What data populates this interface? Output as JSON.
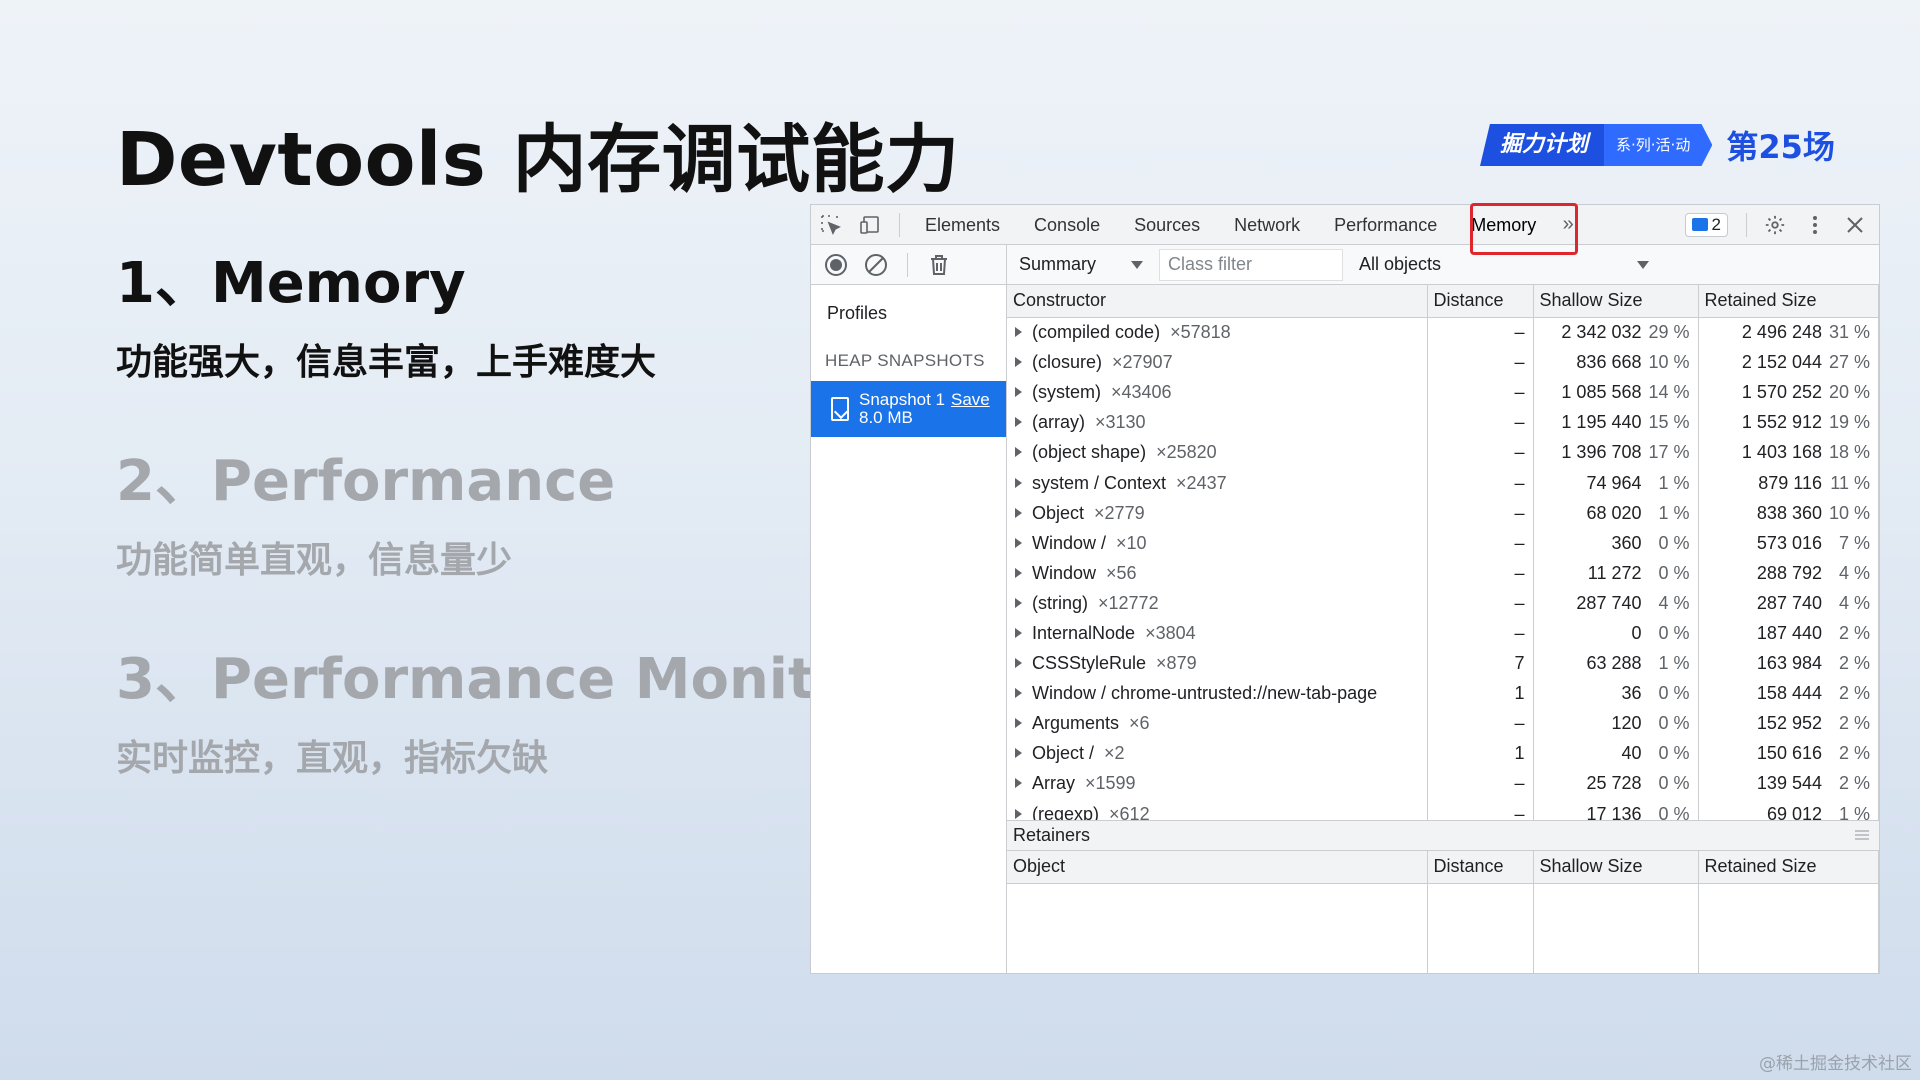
{
  "slide": {
    "title": "Devtools 内存调试能力",
    "items": [
      {
        "head": "1、Memory",
        "sub": "功能强大，信息丰富，上手难度大"
      },
      {
        "head": "2、Performance",
        "sub": "功能简单直观，信息量少"
      },
      {
        "head": "3、Performance Monitor",
        "sub": "实时监控，直观，指标欠缺"
      }
    ],
    "badge": {
      "main": "掘力计划",
      "series": "系·列·活·动",
      "episode": "第25场"
    },
    "watermark": "@稀土掘金技术社区"
  },
  "devtools": {
    "tabs": [
      "Elements",
      "Console",
      "Sources",
      "Network",
      "Performance",
      "Memory"
    ],
    "selected_tab": "Memory",
    "more_tabs": "»",
    "issues_count": "2",
    "toolbar": {
      "view": "Summary",
      "class_filter_placeholder": "Class filter",
      "objects": "All objects"
    },
    "sidebar": {
      "title": "Profiles",
      "section": "HEAP SNAPSHOTS",
      "snapshot_name": "Snapshot 1",
      "snapshot_save": "Save",
      "snapshot_size": "8.0 MB"
    },
    "columns": [
      "Constructor",
      "Distance",
      "Shallow Size",
      "Retained Size"
    ],
    "rows": [
      {
        "name": "(compiled code)",
        "count": "×57818",
        "distance": "–",
        "shallow": "2 342 032",
        "shallow_pct": "29 %",
        "retained": "2 496 248",
        "retained_pct": "31 %"
      },
      {
        "name": "(closure)",
        "count": "×27907",
        "distance": "–",
        "shallow": "836 668",
        "shallow_pct": "10 %",
        "retained": "2 152 044",
        "retained_pct": "27 %"
      },
      {
        "name": "(system)",
        "count": "×43406",
        "distance": "–",
        "shallow": "1 085 568",
        "shallow_pct": "14 %",
        "retained": "1 570 252",
        "retained_pct": "20 %"
      },
      {
        "name": "(array)",
        "count": "×3130",
        "distance": "–",
        "shallow": "1 195 440",
        "shallow_pct": "15 %",
        "retained": "1 552 912",
        "retained_pct": "19 %"
      },
      {
        "name": "(object shape)",
        "count": "×25820",
        "distance": "–",
        "shallow": "1 396 708",
        "shallow_pct": "17 %",
        "retained": "1 403 168",
        "retained_pct": "18 %"
      },
      {
        "name": "system / Context",
        "count": "×2437",
        "distance": "–",
        "shallow": "74 964",
        "shallow_pct": "1 %",
        "retained": "879 116",
        "retained_pct": "11 %"
      },
      {
        "name": "Object",
        "count": "×2779",
        "distance": "–",
        "shallow": "68 020",
        "shallow_pct": "1 %",
        "retained": "838 360",
        "retained_pct": "10 %"
      },
      {
        "name": "Window /",
        "count": "×10",
        "distance": "–",
        "shallow": "360",
        "shallow_pct": "0 %",
        "retained": "573 016",
        "retained_pct": "7 %"
      },
      {
        "name": "Window",
        "count": "×56",
        "distance": "–",
        "shallow": "11 272",
        "shallow_pct": "0 %",
        "retained": "288 792",
        "retained_pct": "4 %"
      },
      {
        "name": "(string)",
        "count": "×12772",
        "distance": "–",
        "shallow": "287 740",
        "shallow_pct": "4 %",
        "retained": "287 740",
        "retained_pct": "4 %"
      },
      {
        "name": "InternalNode",
        "count": "×3804",
        "distance": "–",
        "shallow": "0",
        "shallow_pct": "0 %",
        "retained": "187 440",
        "retained_pct": "2 %"
      },
      {
        "name": "CSSStyleRule",
        "count": "×879",
        "distance": "7",
        "shallow": "63 288",
        "shallow_pct": "1 %",
        "retained": "163 984",
        "retained_pct": "2 %"
      },
      {
        "name": "Window / chrome-untrusted://new-tab-page",
        "count": "",
        "distance": "1",
        "shallow": "36",
        "shallow_pct": "0 %",
        "retained": "158 444",
        "retained_pct": "2 %"
      },
      {
        "name": "Arguments",
        "count": "×6",
        "distance": "–",
        "shallow": "120",
        "shallow_pct": "0 %",
        "retained": "152 952",
        "retained_pct": "2 %"
      },
      {
        "name": "Object /",
        "count": "×2",
        "distance": "1",
        "shallow": "40",
        "shallow_pct": "0 %",
        "retained": "150 616",
        "retained_pct": "2 %"
      },
      {
        "name": "Array",
        "count": "×1599",
        "distance": "–",
        "shallow": "25 728",
        "shallow_pct": "0 %",
        "retained": "139 544",
        "retained_pct": "2 %"
      },
      {
        "name": "(regexp)",
        "count": "×612",
        "distance": "–",
        "shallow": "17 136",
        "shallow_pct": "0 %",
        "retained": "69 012",
        "retained_pct": "1 %"
      }
    ],
    "retainers": {
      "title": "Retainers",
      "columns": [
        "Object",
        "Distance",
        "Shallow Size",
        "Retained Size"
      ]
    },
    "colors": {
      "accent": "#1a73e8",
      "highlight": "#e0262d"
    }
  }
}
